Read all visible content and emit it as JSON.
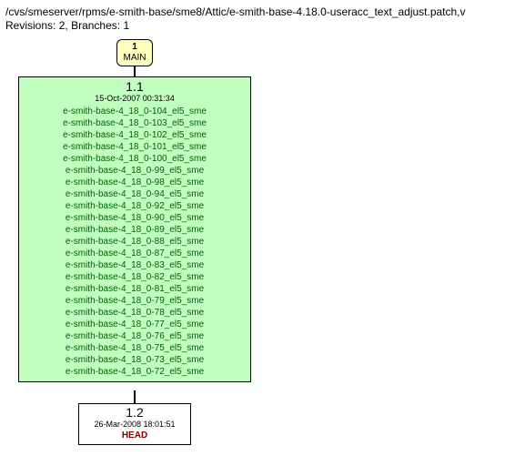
{
  "header": {
    "path": "/cvs/smeserver/rpms/e-smith-base/sme8/Attic/e-smith-base-4.18.0-useracc_text_adjust.patch,v",
    "revisions_label": "Revisions:",
    "revisions_count": "2,",
    "branches_label": "Branches:",
    "branches_count": "1"
  },
  "branch": {
    "num": "1",
    "name": "MAIN"
  },
  "rev1": {
    "version": "1.1",
    "date": "15-Oct-2007 00:31:34",
    "tags": [
      "e-smith-base-4_18_0-104_el5_sme",
      "e-smith-base-4_18_0-103_el5_sme",
      "e-smith-base-4_18_0-102_el5_sme",
      "e-smith-base-4_18_0-101_el5_sme",
      "e-smith-base-4_18_0-100_el5_sme",
      "e-smith-base-4_18_0-99_el5_sme",
      "e-smith-base-4_18_0-98_el5_sme",
      "e-smith-base-4_18_0-94_el5_sme",
      "e-smith-base-4_18_0-92_el5_sme",
      "e-smith-base-4_18_0-90_el5_sme",
      "e-smith-base-4_18_0-89_el5_sme",
      "e-smith-base-4_18_0-88_el5_sme",
      "e-smith-base-4_18_0-87_el5_sme",
      "e-smith-base-4_18_0-83_el5_sme",
      "e-smith-base-4_18_0-82_el5_sme",
      "e-smith-base-4_18_0-81_el5_sme",
      "e-smith-base-4_18_0-79_el5_sme",
      "e-smith-base-4_18_0-78_el5_sme",
      "e-smith-base-4_18_0-77_el5_sme",
      "e-smith-base-4_18_0-76_el5_sme",
      "e-smith-base-4_18_0-75_el5_sme",
      "e-smith-base-4_18_0-73_el5_sme",
      "e-smith-base-4_18_0-72_el5_sme"
    ]
  },
  "rev2": {
    "version": "1.2",
    "date": "26-Mar-2008 18:01:51",
    "head": "HEAD"
  }
}
